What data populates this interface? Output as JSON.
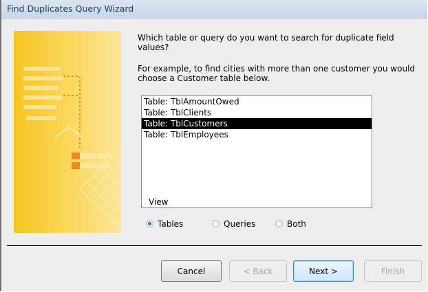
{
  "window": {
    "title": "Find Duplicates Query Wizard"
  },
  "wizard": {
    "prompt": "Which table or query do you want to search for duplicate field values?",
    "example": "For example, to find cities with more than one customer you would choose a Customer table below.",
    "tables": [
      "Table: TblAmountOwed",
      "Table: TblClients",
      "Table: TblCustomers",
      "Table: TblEmployees"
    ],
    "selected_index": 2,
    "view": {
      "label": "View",
      "options": [
        "Tables",
        "Queries",
        "Both"
      ],
      "selected": "Tables"
    }
  },
  "buttons": {
    "cancel": "Cancel",
    "back": "< Back",
    "next": "Next >",
    "finish": "Finish"
  },
  "colors": {
    "banner": "#f6c521",
    "selection": "#000000",
    "radio_accent": "#2d6ad3"
  }
}
